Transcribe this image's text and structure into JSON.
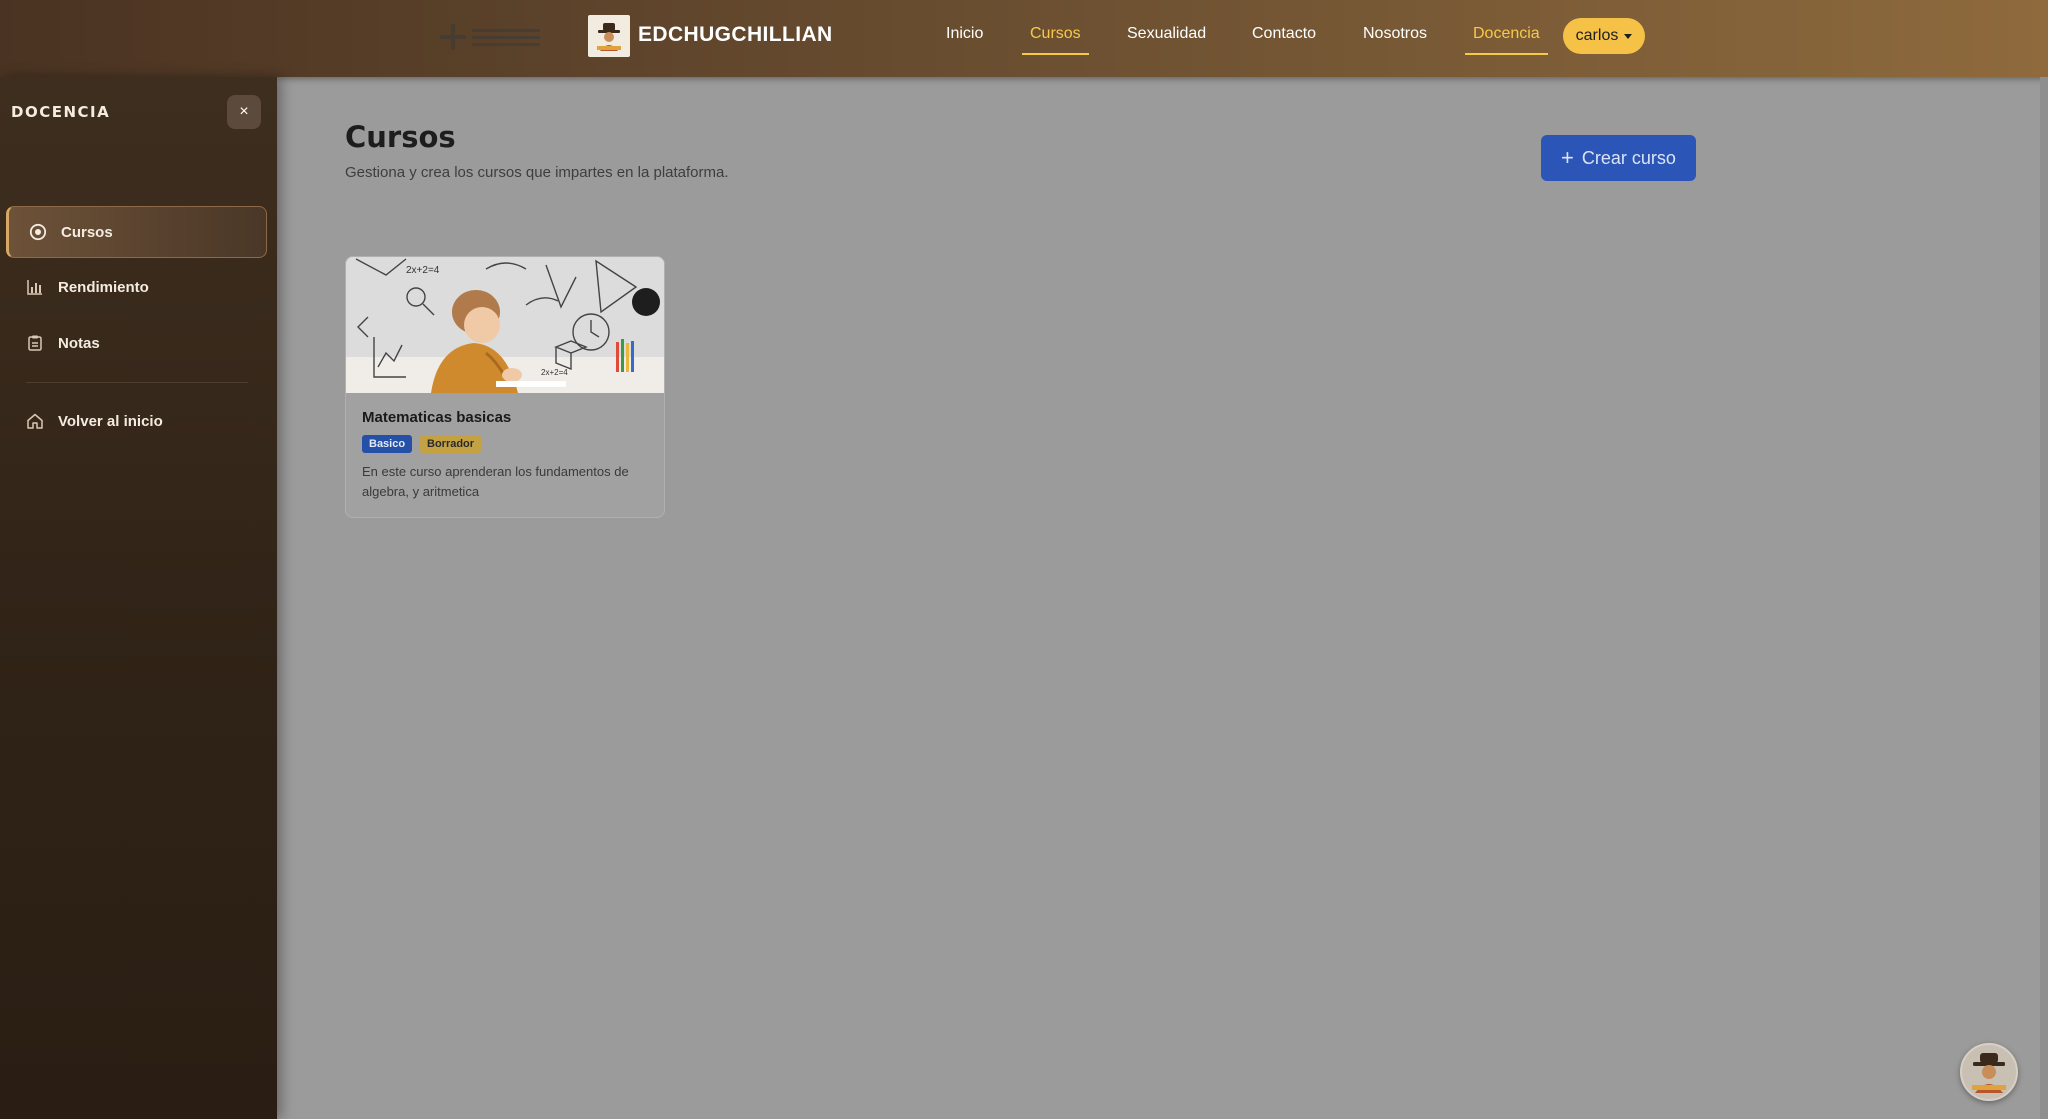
{
  "header": {
    "brand": "EDCHUGCHILLIAN",
    "nav": [
      {
        "label": "Inicio"
      },
      {
        "label": "Cursos"
      },
      {
        "label": "Sexualidad"
      },
      {
        "label": "Contacto"
      },
      {
        "label": "Nosotros"
      },
      {
        "label": "Docencia"
      }
    ],
    "user": "carlos",
    "accent_color": "#f7c948"
  },
  "sidebar": {
    "title": "DOCENCIA",
    "close_label": "×",
    "items": [
      {
        "label": "Cursos",
        "icon": "play-circle-icon"
      },
      {
        "label": "Rendimiento",
        "icon": "bar-chart-icon"
      },
      {
        "label": "Notas",
        "icon": "clipboard-icon"
      }
    ],
    "footer_item": {
      "label": "Volver al inicio",
      "icon": "home-icon"
    }
  },
  "main": {
    "title": "Cursos",
    "subtitle": "Gestiona y crea los cursos que impartes en la plataforma.",
    "create_button": "Crear curso",
    "courses": [
      {
        "name": "Matematicas basicas",
        "level": "Basico",
        "status": "Borrador",
        "description": "En este curso aprenderan los fundamentos de algebra, y aritmetica"
      }
    ]
  }
}
